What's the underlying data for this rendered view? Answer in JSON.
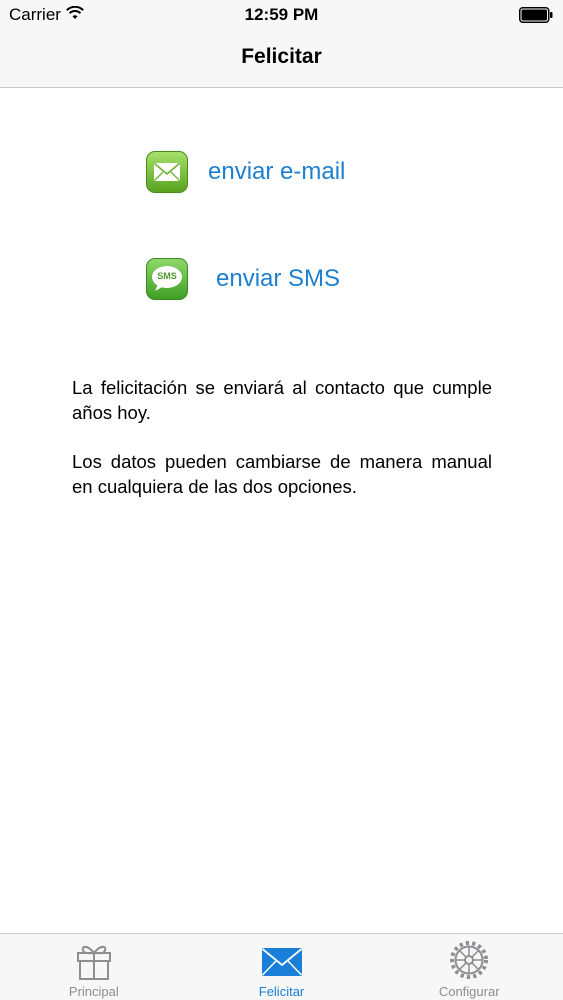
{
  "status_bar": {
    "carrier": "Carrier",
    "time": "12:59 PM"
  },
  "nav": {
    "title": "Felicitar"
  },
  "actions": {
    "email": {
      "label": "enviar e-mail",
      "icon": "mail-icon"
    },
    "sms": {
      "label": "enviar SMS",
      "icon": "sms-icon",
      "icon_text": "SMS"
    }
  },
  "info": {
    "paragraph_1": "La felicitación se enviará al contacto que cumple años  hoy.",
    "paragraph_2": "Los datos pueden cambiarse de manera manual en cualquiera de las dos opciones."
  },
  "tabs": [
    {
      "label": "Principal",
      "icon": "gift-icon",
      "active": false
    },
    {
      "label": "Felicitar",
      "icon": "envelope-icon",
      "active": true
    },
    {
      "label": "Configurar",
      "icon": "gear-icon",
      "active": false
    }
  ],
  "colors": {
    "accent": "#1a7fd8",
    "link": "#1d7fcf",
    "inactive": "#8e8e93",
    "bar_bg": "#f7f7f7"
  }
}
